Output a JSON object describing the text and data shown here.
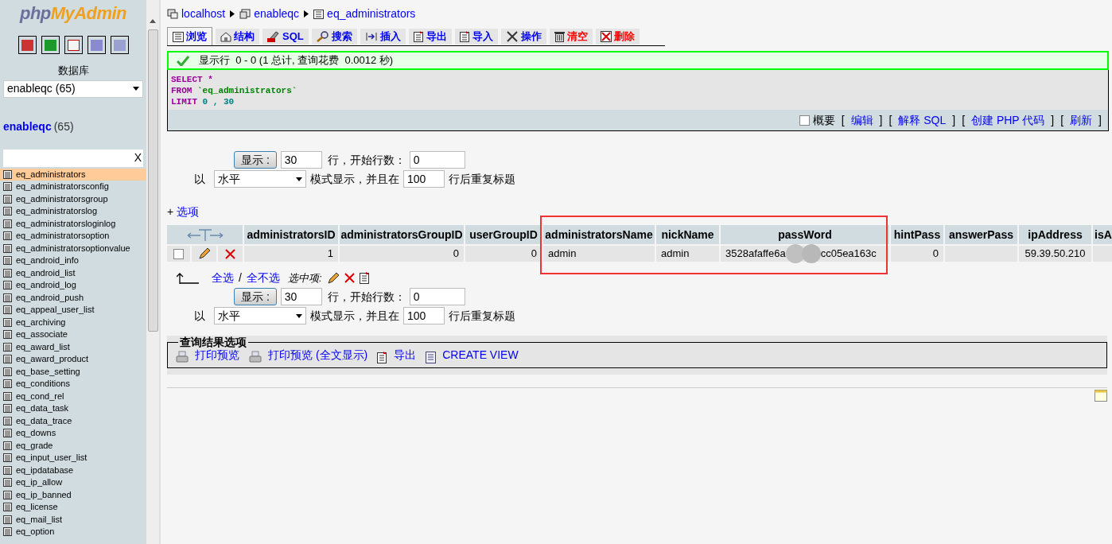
{
  "sidebar": {
    "logo_part_1": "php",
    "logo_part_2": "MyAdmin",
    "database_label": "数据库",
    "database_select": "enableqc (65)",
    "db_name": "enableqc",
    "db_count": "(65)",
    "filter_clear": "X",
    "tables": [
      {
        "name": "eq_administrators",
        "selected": true
      },
      {
        "name": "eq_administratorsconfig",
        "selected": false
      },
      {
        "name": "eq_administratorsgroup",
        "selected": false
      },
      {
        "name": "eq_administratorslog",
        "selected": false
      },
      {
        "name": "eq_administratorsloginlog",
        "selected": false
      },
      {
        "name": "eq_administratorsoption",
        "selected": false
      },
      {
        "name": "eq_administratorsoptionvalue",
        "selected": false
      },
      {
        "name": "eq_android_info",
        "selected": false
      },
      {
        "name": "eq_android_list",
        "selected": false
      },
      {
        "name": "eq_android_log",
        "selected": false
      },
      {
        "name": "eq_android_push",
        "selected": false
      },
      {
        "name": "eq_appeal_user_list",
        "selected": false
      },
      {
        "name": "eq_archiving",
        "selected": false
      },
      {
        "name": "eq_associate",
        "selected": false
      },
      {
        "name": "eq_award_list",
        "selected": false
      },
      {
        "name": "eq_award_product",
        "selected": false
      },
      {
        "name": "eq_base_setting",
        "selected": false
      },
      {
        "name": "eq_conditions",
        "selected": false
      },
      {
        "name": "eq_cond_rel",
        "selected": false
      },
      {
        "name": "eq_data_task",
        "selected": false
      },
      {
        "name": "eq_data_trace",
        "selected": false
      },
      {
        "name": "eq_downs",
        "selected": false
      },
      {
        "name": "eq_grade",
        "selected": false
      },
      {
        "name": "eq_input_user_list",
        "selected": false
      },
      {
        "name": "eq_ipdatabase",
        "selected": false
      },
      {
        "name": "eq_ip_allow",
        "selected": false
      },
      {
        "name": "eq_ip_banned",
        "selected": false
      },
      {
        "name": "eq_license",
        "selected": false
      },
      {
        "name": "eq_mail_list",
        "selected": false
      },
      {
        "name": "eq_option",
        "selected": false
      }
    ]
  },
  "breadcrumb": [
    {
      "kind": "server",
      "label": "localhost"
    },
    {
      "kind": "database",
      "label": "enableqc"
    },
    {
      "kind": "table",
      "label": "eq_administrators"
    }
  ],
  "tabs": [
    {
      "kind": "browse",
      "label": "浏览",
      "selected": true,
      "danger": false
    },
    {
      "kind": "structure",
      "label": "结构",
      "selected": false,
      "danger": false
    },
    {
      "kind": "sql",
      "label": "SQL",
      "selected": false,
      "danger": false
    },
    {
      "kind": "search",
      "label": "搜索",
      "selected": false,
      "danger": false
    },
    {
      "kind": "insert",
      "label": "插入",
      "selected": false,
      "danger": false
    },
    {
      "kind": "export",
      "label": "导出",
      "selected": false,
      "danger": false
    },
    {
      "kind": "import",
      "label": "导入",
      "selected": false,
      "danger": false
    },
    {
      "kind": "operations",
      "label": "操作",
      "selected": false,
      "danger": false
    },
    {
      "kind": "empty",
      "label": "清空",
      "selected": false,
      "danger": true
    },
    {
      "kind": "drop",
      "label": "删除",
      "selected": false,
      "danger": true
    }
  ],
  "message": "显示行  0 - 0 (1 总计, 查询花费  0.0012 秒)",
  "sql": [
    [
      {
        "kind": "keyword",
        "text": "SELECT"
      },
      {
        "kind": "keyword",
        "text": " *"
      }
    ],
    [
      {
        "kind": "keyword",
        "text": "FROM"
      },
      {
        "kind": "identifier",
        "text": " `eq_administrators`"
      }
    ],
    [
      {
        "kind": "keyword",
        "text": "LIMIT"
      },
      {
        "kind": "number",
        "text": " 0 , 30"
      }
    ]
  ],
  "sql_options": {
    "profiling_label": "概要",
    "profiling_checked": false,
    "links": [
      {
        "open": "[",
        "label": "编辑",
        "close": "]"
      },
      {
        "open": "[",
        "label": "解释 SQL",
        "close": "]"
      },
      {
        "open": "[",
        "label": "创建 PHP 代码",
        "close": "]"
      },
      {
        "open": "[",
        "label": "刷新",
        "close": "]"
      }
    ]
  },
  "navigation": [
    {
      "show_button": "显示 :",
      "rows": "30",
      "rows_label": "行，开始行数：",
      "start": "0",
      "mode_prefix": "以",
      "mode": "水平",
      "mode_label": "模式显示，并且在",
      "repeat": "100",
      "repeat_label": "行后重复标题"
    },
    {
      "show_button": "显示 :",
      "rows": "30",
      "rows_label": "行，开始行数：",
      "start": "0",
      "mode_prefix": "以",
      "mode": "水平",
      "mode_label": "模式显示，并且在",
      "repeat": "100",
      "repeat_label": "行后重复标题"
    }
  ],
  "options_plus": "+",
  "options_link": "选项",
  "table": {
    "columns": [
      "administratorsID",
      "administratorsGroupID",
      "userGroupID",
      "administratorsName",
      "nickName",
      "passWord",
      "hintPass",
      "answerPass",
      "ipAddress",
      "isA"
    ],
    "rows": [
      {
        "checked": false,
        "cells": [
          {
            "kind": "number",
            "text": "1"
          },
          {
            "kind": "number",
            "text": "0"
          },
          {
            "kind": "number",
            "text": "0"
          },
          {
            "kind": "text",
            "text": "admin"
          },
          {
            "kind": "text",
            "text": "admin"
          },
          {
            "kind": "masked",
            "start": "3528afaffe6a",
            "end": "cc05ea163c"
          },
          {
            "kind": "number",
            "text": "0"
          },
          {
            "kind": "blank"
          },
          {
            "kind": "address",
            "text": "59.39.50.210"
          },
          {
            "kind": "blank"
          }
        ]
      }
    ]
  },
  "bulk": {
    "select_all": "全选",
    "separator": "/",
    "select_none": "全不选",
    "with_selected": "选中项:"
  },
  "query_results": {
    "legend": "查询结果选项",
    "links": [
      {
        "kind": "print",
        "label": "打印预览"
      },
      {
        "kind": "print",
        "label": "打印预览 (全文显示)"
      },
      {
        "kind": "export",
        "label": "导出"
      },
      {
        "kind": "view",
        "label": "CREATE VIEW"
      }
    ]
  }
}
